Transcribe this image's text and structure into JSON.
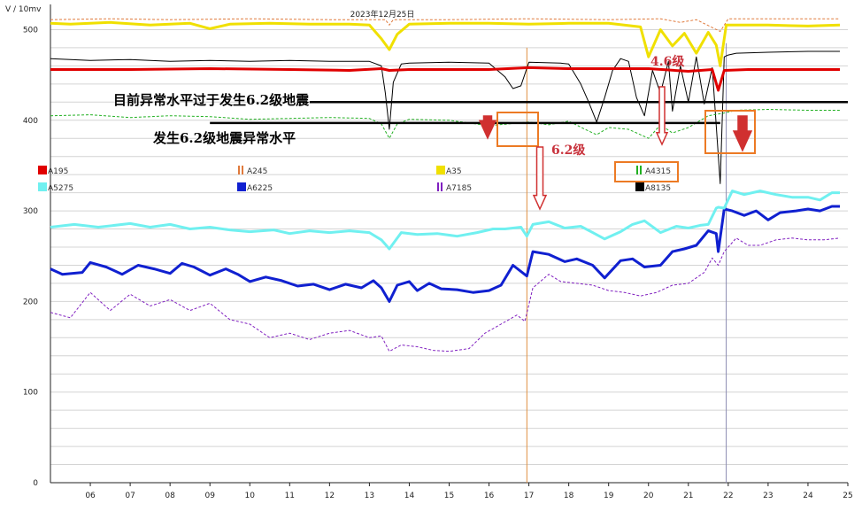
{
  "chart_data": {
    "type": "line",
    "title": "2023年12月25日",
    "ylabel": "V / 10mv",
    "ylim": [
      0,
      520
    ],
    "yticks": [
      0,
      100,
      200,
      300,
      400,
      500
    ],
    "grid": true,
    "xlim": [
      5.0,
      25.0
    ],
    "x_tick_labels": [
      "06",
      "07",
      "08",
      "09",
      "10",
      "11",
      "12",
      "13",
      "14",
      "15",
      "16",
      "17",
      "18",
      "19",
      "20",
      "21",
      "22",
      "23",
      "24",
      "25"
    ],
    "legend_placement": "inside-top",
    "series": [
      {
        "name": "A195",
        "color": "#e00000",
        "style": "solid",
        "width": 3,
        "x": [
          5.0,
          7.0,
          9.0,
          11.0,
          12.5,
          13.3,
          13.5,
          14.0,
          16.0,
          17.0,
          18.0,
          20.0,
          21.0,
          21.6,
          21.75,
          21.9,
          22.5,
          24.0,
          24.8
        ],
        "y": [
          456,
          456,
          457,
          456,
          455,
          457,
          455,
          456,
          456,
          458,
          457,
          457,
          454,
          456,
          433,
          455,
          456,
          456,
          456
        ]
      },
      {
        "name": "A245",
        "color": "#e07a3c",
        "style": "dashed",
        "width": 1,
        "x": [
          5.0,
          6.5,
          8.0,
          10.0,
          12.0,
          13.4,
          13.5,
          13.6,
          15.0,
          17.0,
          19.0,
          20.3,
          20.8,
          21.2,
          21.8,
          22.0,
          23.0,
          24.8
        ],
        "y": [
          511,
          512,
          511,
          512,
          511,
          511,
          505,
          511,
          511,
          512,
          511,
          512,
          508,
          511,
          498,
          512,
          512,
          512
        ]
      },
      {
        "name": "A35",
        "color": "#f0e000",
        "style": "solid",
        "width": 3,
        "x": [
          5.0,
          5.5,
          6.5,
          7.5,
          8.5,
          9.0,
          9.5,
          10.5,
          11.5,
          12.5,
          13.0,
          13.3,
          13.5,
          13.7,
          14.0,
          15.0,
          16.0,
          17.0,
          18.0,
          19.0,
          19.8,
          20.0,
          20.3,
          20.6,
          20.9,
          21.2,
          21.5,
          21.7,
          21.8,
          21.95,
          22.2,
          23.0,
          24.0,
          24.8
        ],
        "y": [
          507,
          506,
          508,
          505,
          507,
          501,
          506,
          507,
          506,
          506,
          505,
          490,
          478,
          495,
          506,
          507,
          507,
          506,
          507,
          507,
          503,
          470,
          500,
          482,
          496,
          474,
          497,
          483,
          460,
          505,
          505,
          505,
          504,
          505
        ]
      },
      {
        "name": "A4315",
        "color": "#22b022",
        "style": "dashed",
        "width": 1,
        "x": [
          5.0,
          6.0,
          7.0,
          8.0,
          9.0,
          10.0,
          11.0,
          12.0,
          13.0,
          13.3,
          13.5,
          13.7,
          14.0,
          15.0,
          16.0,
          17.0,
          17.5,
          18.0,
          18.5,
          18.7,
          19.0,
          19.5,
          20.0,
          20.3,
          20.6,
          21.0,
          21.5,
          21.9,
          22.2,
          23.0,
          24.0,
          24.8
        ],
        "y": [
          405,
          406,
          403,
          405,
          404,
          401,
          402,
          403,
          402,
          396,
          380,
          396,
          401,
          400,
          394,
          398,
          395,
          399,
          388,
          384,
          392,
          390,
          380,
          395,
          386,
          392,
          405,
          408,
          411,
          412,
          411,
          411
        ]
      },
      {
        "name": "A5275",
        "color": "#70f0f0",
        "style": "solid",
        "width": 3,
        "x": [
          5.0,
          5.6,
          6.2,
          7.0,
          7.5,
          8.0,
          8.5,
          9.0,
          9.5,
          10.0,
          10.6,
          11.0,
          11.5,
          12.0,
          12.5,
          13.0,
          13.3,
          13.5,
          13.8,
          14.2,
          14.7,
          15.2,
          15.7,
          16.1,
          16.4,
          16.8,
          16.95,
          17.1,
          17.5,
          17.9,
          18.3,
          18.6,
          18.9,
          19.3,
          19.6,
          19.9,
          20.3,
          20.7,
          21.0,
          21.3,
          21.5,
          21.7,
          21.75,
          21.9,
          22.1,
          22.4,
          22.8,
          23.2,
          23.6,
          24.0,
          24.3,
          24.6,
          24.8
        ],
        "y": [
          282,
          285,
          282,
          286,
          282,
          285,
          280,
          282,
          279,
          277,
          279,
          275,
          278,
          276,
          278,
          276,
          268,
          258,
          276,
          274,
          275,
          272,
          276,
          280,
          280,
          282,
          272,
          285,
          288,
          281,
          283,
          276,
          269,
          277,
          285,
          289,
          276,
          283,
          281,
          284,
          285,
          303,
          304,
          303,
          322,
          318,
          322,
          318,
          315,
          315,
          312,
          320,
          320
        ]
      },
      {
        "name": "A6225",
        "color": "#1020d0",
        "style": "solid",
        "width": 3,
        "x": [
          5.0,
          5.3,
          5.8,
          6.0,
          6.4,
          6.8,
          7.2,
          7.6,
          8.0,
          8.3,
          8.6,
          9.0,
          9.4,
          9.7,
          10.0,
          10.4,
          10.8,
          11.2,
          11.6,
          12.0,
          12.4,
          12.8,
          13.1,
          13.3,
          13.5,
          13.7,
          14.0,
          14.2,
          14.5,
          14.8,
          15.2,
          15.6,
          16.0,
          16.3,
          16.6,
          16.95,
          17.1,
          17.5,
          17.9,
          18.2,
          18.6,
          18.9,
          19.3,
          19.6,
          19.9,
          20.3,
          20.6,
          20.9,
          21.2,
          21.5,
          21.7,
          21.75,
          21.9,
          22.1,
          22.4,
          22.7,
          23.0,
          23.3,
          23.7,
          24.0,
          24.3,
          24.6,
          24.8
        ],
        "y": [
          236,
          230,
          232,
          243,
          238,
          230,
          240,
          236,
          231,
          242,
          238,
          229,
          236,
          230,
          222,
          227,
          223,
          217,
          219,
          213,
          219,
          215,
          223,
          215,
          200,
          218,
          222,
          212,
          220,
          214,
          213,
          210,
          212,
          218,
          240,
          228,
          255,
          252,
          244,
          247,
          240,
          226,
          245,
          247,
          238,
          240,
          255,
          258,
          262,
          278,
          275,
          255,
          302,
          300,
          295,
          300,
          290,
          298,
          300,
          302,
          300,
          305,
          305
        ]
      },
      {
        "name": "A7185",
        "color": "#8020c0",
        "style": "dashed",
        "width": 1,
        "x": [
          5.0,
          5.5,
          6.0,
          6.5,
          7.0,
          7.5,
          8.0,
          8.5,
          9.0,
          9.5,
          10.0,
          10.5,
          11.0,
          11.5,
          12.0,
          12.5,
          13.0,
          13.3,
          13.5,
          13.8,
          14.2,
          14.6,
          15.0,
          15.5,
          15.9,
          16.3,
          16.7,
          16.9,
          17.1,
          17.5,
          17.8,
          18.2,
          18.6,
          19.0,
          19.4,
          19.8,
          20.2,
          20.6,
          21.0,
          21.4,
          21.6,
          21.75,
          21.9,
          22.2,
          22.5,
          22.8,
          23.2,
          23.6,
          24.0,
          24.4,
          24.8
        ],
        "y": [
          188,
          182,
          210,
          190,
          208,
          195,
          202,
          190,
          198,
          180,
          175,
          160,
          165,
          158,
          165,
          168,
          160,
          162,
          145,
          152,
          150,
          146,
          145,
          148,
          165,
          175,
          185,
          178,
          215,
          230,
          222,
          220,
          218,
          212,
          210,
          206,
          210,
          218,
          220,
          232,
          248,
          240,
          255,
          270,
          262,
          262,
          268,
          270,
          268,
          268,
          270
        ]
      },
      {
        "name": "A8135",
        "color": "#000000",
        "style": "solid",
        "width": 1,
        "x": [
          5.0,
          6.0,
          7.0,
          8.0,
          9.0,
          10.0,
          11.0,
          12.0,
          13.0,
          13.3,
          13.4,
          13.5,
          13.6,
          13.8,
          14.0,
          15.0,
          16.0,
          16.4,
          16.6,
          16.8,
          17.0,
          17.8,
          18.0,
          18.3,
          18.5,
          18.7,
          18.9,
          19.1,
          19.3,
          19.5,
          19.7,
          19.9,
          20.1,
          20.3,
          20.5,
          20.6,
          20.8,
          21.0,
          21.2,
          21.4,
          21.6,
          21.8,
          21.9,
          22.0,
          22.2,
          23.0,
          24.0,
          24.8
        ],
        "y": [
          468,
          466,
          467,
          465,
          466,
          465,
          466,
          465,
          465,
          460,
          430,
          390,
          442,
          462,
          463,
          464,
          463,
          448,
          435,
          438,
          464,
          463,
          462,
          440,
          420,
          398,
          425,
          455,
          468,
          465,
          425,
          405,
          455,
          430,
          465,
          410,
          460,
          420,
          470,
          418,
          458,
          330,
          470,
          472,
          474,
          475,
          476,
          476
        ]
      }
    ],
    "annotations": [
      {
        "text": "目前异常水平过于发生6.2级地震",
        "value": 420
      },
      {
        "text": "发生6.2级地震异常水平",
        "value": 397
      },
      {
        "text": "6.2级",
        "x": 17.0
      },
      {
        "text": "4.6级",
        "x": 22.0
      }
    ]
  }
}
